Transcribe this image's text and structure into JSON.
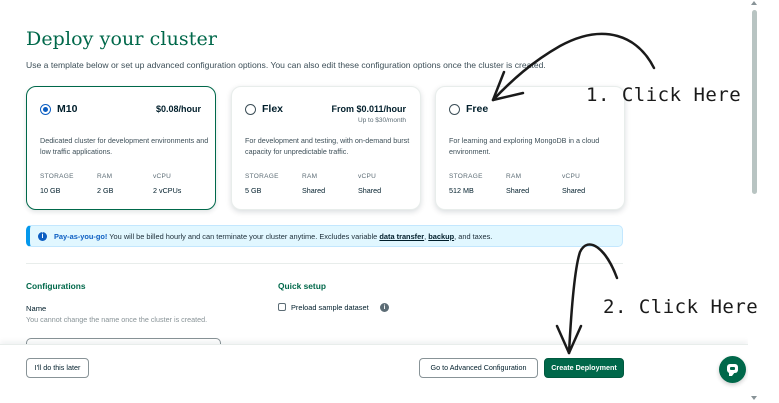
{
  "page": {
    "title": "Deploy your cluster",
    "subtitle": "Use a template below or set up advanced configuration options. You can also edit these configuration options once the cluster is created."
  },
  "tiers": [
    {
      "name": "M10",
      "price": "$0.08/hour",
      "price_sub": "",
      "selected": true,
      "description": "Dedicated cluster for development environments and low traffic applications.",
      "specs": [
        {
          "label": "STORAGE",
          "value": "10 GB"
        },
        {
          "label": "RAM",
          "value": "2 GB"
        },
        {
          "label": "vCPU",
          "value": "2 vCPUs"
        }
      ]
    },
    {
      "name": "Flex",
      "price": "From $0.011/hour",
      "price_sub": "Up to $30/month",
      "selected": false,
      "description": "For development and testing, with on-demand burst capacity for unpredictable traffic.",
      "specs": [
        {
          "label": "STORAGE",
          "value": "5 GB"
        },
        {
          "label": "RAM",
          "value": "Shared"
        },
        {
          "label": "vCPU",
          "value": "Shared"
        }
      ]
    },
    {
      "name": "Free",
      "price": "",
      "price_sub": "",
      "selected": false,
      "description": "For learning and exploring MongoDB in a cloud environment.",
      "specs": [
        {
          "label": "STORAGE",
          "value": "512 MB"
        },
        {
          "label": "RAM",
          "value": "Shared"
        },
        {
          "label": "vCPU",
          "value": "Shared"
        }
      ]
    }
  ],
  "banner": {
    "lead": "Pay-as-you-go!",
    "text": " You will be billed hourly and can terminate your cluster anytime. Excludes variable ",
    "link1": "data transfer",
    "sep": ", ",
    "link2": "backup",
    "tail": ", and taxes."
  },
  "configurations": {
    "heading": "Configurations",
    "name_label": "Name",
    "name_help": "You cannot change the name once the cluster is created."
  },
  "quick_setup": {
    "heading": "Quick setup",
    "preload_label": "Preload sample dataset",
    "preload_checked": false
  },
  "footer": {
    "later_label": "I'll do this later",
    "advanced_label": "Go to Advanced Configuration",
    "create_label": "Create Deployment"
  },
  "annotations": {
    "step1": "1. Click Here",
    "step2": "2. Click Here"
  },
  "colors": {
    "brand_green": "#00684a",
    "accent_blue": "#0c5ec2",
    "banner_bg": "#e1f7ff"
  }
}
